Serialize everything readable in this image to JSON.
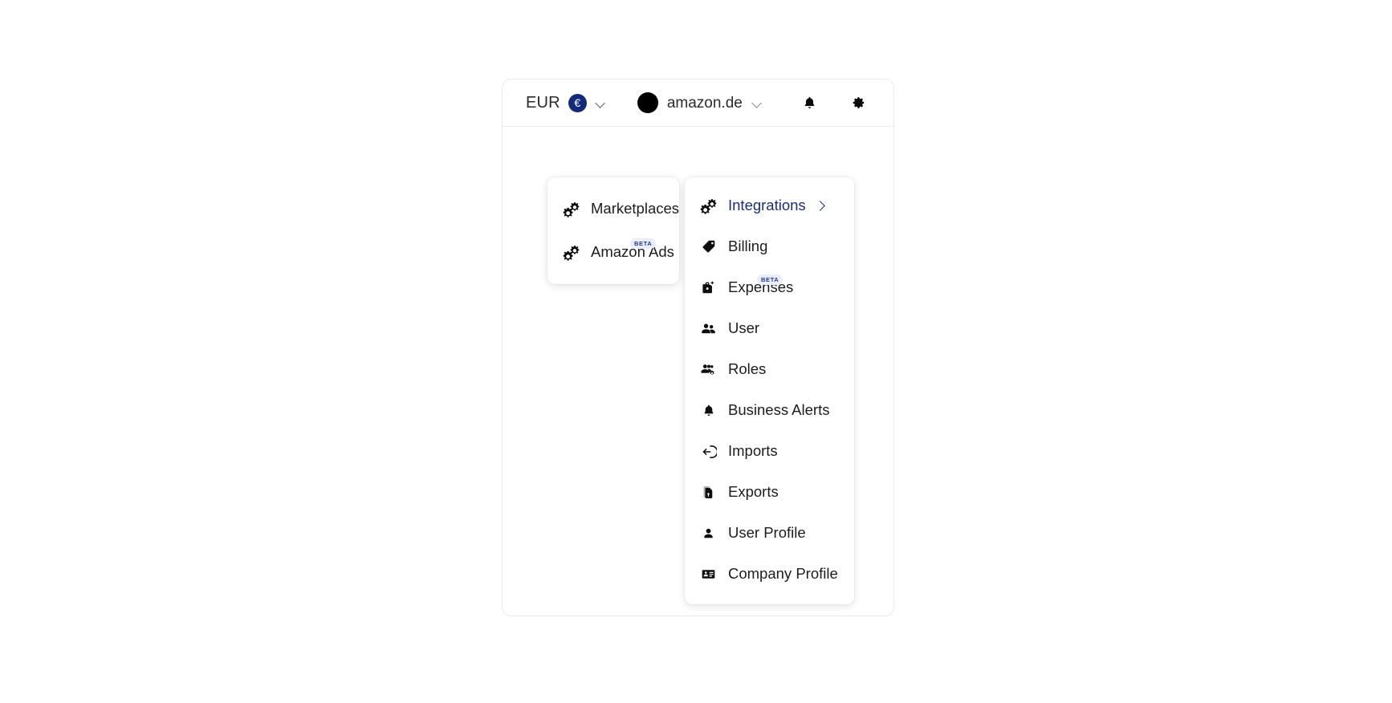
{
  "header": {
    "currency": {
      "code": "EUR",
      "badge_symbol": "€",
      "badge_color": "#13297a"
    },
    "marketplace": {
      "name": "amazon.de",
      "flag": "germany-flag"
    },
    "notifications_icon": "bell-icon",
    "settings_icon": "gear-icon",
    "currency_chevron_icon": "chevron-down-icon",
    "marketplace_chevron_icon": "chevron-down-icon"
  },
  "settings_menu": {
    "active_color": "#1b2f7d",
    "items": [
      {
        "label": "Integrations",
        "icon": "gears-icon",
        "active": true,
        "has_submenu": true,
        "submenu_icon": "chevron-right-icon",
        "badge": null
      },
      {
        "label": "Billing",
        "icon": "price-tag-icon",
        "active": false,
        "has_submenu": false,
        "submenu_icon": null,
        "badge": null
      },
      {
        "label": "Expenses",
        "icon": "briefcase-plus-icon",
        "active": false,
        "has_submenu": false,
        "submenu_icon": null,
        "badge": "BETA"
      },
      {
        "label": "User",
        "icon": "users-icon",
        "active": false,
        "has_submenu": false,
        "submenu_icon": null,
        "badge": null
      },
      {
        "label": "Roles",
        "icon": "user-group-gear-icon",
        "active": false,
        "has_submenu": false,
        "submenu_icon": null,
        "badge": null
      },
      {
        "label": "Business Alerts",
        "icon": "bell-icon",
        "active": false,
        "has_submenu": false,
        "submenu_icon": null,
        "badge": null
      },
      {
        "label": "Imports",
        "icon": "import-arrow-icon",
        "active": false,
        "has_submenu": false,
        "submenu_icon": null,
        "badge": null
      },
      {
        "label": "Exports",
        "icon": "export-file-icon",
        "active": false,
        "has_submenu": false,
        "submenu_icon": null,
        "badge": null
      },
      {
        "label": "User Profile",
        "icon": "person-icon",
        "active": false,
        "has_submenu": false,
        "submenu_icon": null,
        "badge": null
      },
      {
        "label": "Company Profile",
        "icon": "id-card-icon",
        "active": false,
        "has_submenu": false,
        "submenu_icon": null,
        "badge": null
      }
    ]
  },
  "integrations_submenu": {
    "items": [
      {
        "label": "Marketplaces",
        "icon": "gears-icon",
        "badge": null
      },
      {
        "label": "Amazon Ads",
        "icon": "gears-icon",
        "badge": "BETA"
      }
    ]
  },
  "badges": {
    "beta_text": "BETA",
    "beta_bg": "#eaeefb",
    "beta_fg": "#24398c"
  }
}
